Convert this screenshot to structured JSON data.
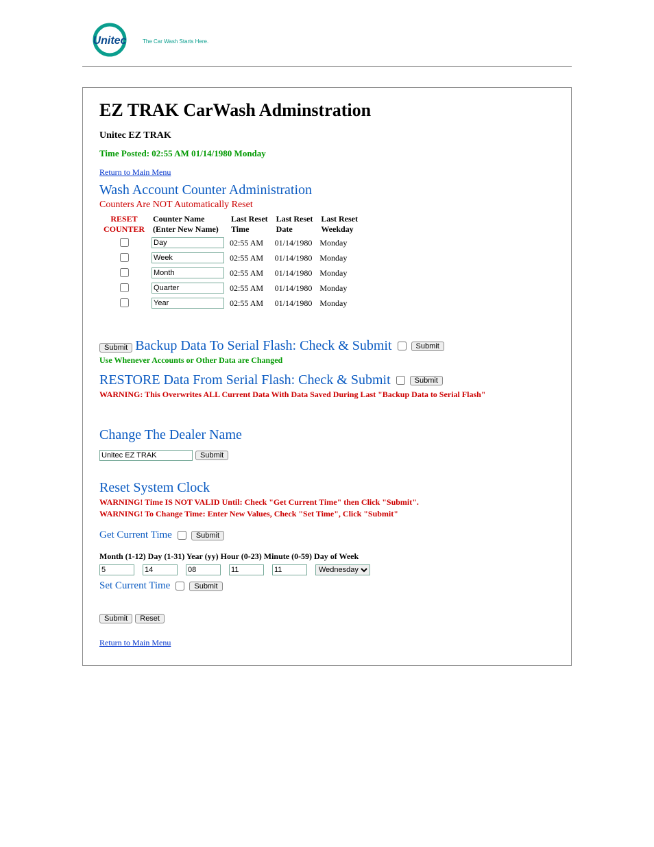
{
  "logo": {
    "brand": "Unitec",
    "tagline": "The Car Wash Starts Here."
  },
  "header": {
    "title": "EZ TRAK CarWash Adminstration",
    "subtitle": "Unitec EZ TRAK",
    "time_posted": "Time Posted: 02:55 AM 01/14/1980 Monday",
    "return_link": "Return to Main Menu"
  },
  "counters": {
    "heading": "Wash Account Counter Administration",
    "sub": "Counters Are NOT Automatically Reset",
    "cols": {
      "reset1": "RESET",
      "reset2": "COUNTER",
      "name1": "Counter Name",
      "name2": "(Enter New Name)",
      "time1": "Last Reset",
      "time2": "Time",
      "date1": "Last Reset",
      "date2": "Date",
      "wd1": "Last Reset",
      "wd2": "Weekday"
    },
    "rows": [
      {
        "name": "Day",
        "time": "02:55 AM",
        "date": "01/14/1980",
        "weekday": "Monday"
      },
      {
        "name": "Week",
        "time": "02:55 AM",
        "date": "01/14/1980",
        "weekday": "Monday"
      },
      {
        "name": "Month",
        "time": "02:55 AM",
        "date": "01/14/1980",
        "weekday": "Monday"
      },
      {
        "name": "Quarter",
        "time": "02:55 AM",
        "date": "01/14/1980",
        "weekday": "Monday"
      },
      {
        "name": "Year",
        "time": "02:55 AM",
        "date": "01/14/1980",
        "weekday": "Monday"
      }
    ],
    "submit": "Submit"
  },
  "backup": {
    "heading": "Backup Data To Serial Flash: Check & Submit",
    "submit": "Submit",
    "note": "Use Whenever Accounts or Other Data are Changed"
  },
  "restore": {
    "heading": "RESTORE Data From Serial Flash: Check & Submit",
    "submit": "Submit",
    "warn": "WARNING: This Overwrites ALL Current Data With Data Saved During Last \"Backup Data to Serial Flash\""
  },
  "dealer": {
    "heading": "Change The Dealer Name",
    "value": "Unitec EZ TRAK",
    "submit": "Submit"
  },
  "clock": {
    "heading": "Reset System Clock",
    "warn1": "WARNING! Time IS NOT VALID Until: Check \"Get Current Time\" then Click \"Submit\".",
    "warn2": "WARNING! To Change Time: Enter New Values, Check \"Set Time\", Click \"Submit\"",
    "get_label": "Get Current Time",
    "get_submit": "Submit",
    "labels": "Month (1-12) Day (1-31) Year (yy) Hour (0-23) Minute (0-59)   Day of Week",
    "month": "5",
    "day": "14",
    "year": "08",
    "hour": "11",
    "minute": "11",
    "dow": "Wednesday",
    "set_label": "Set Current Time",
    "set_submit": "Submit"
  },
  "footer": {
    "submit": "Submit",
    "reset": "Reset",
    "return_link": "Return to Main Menu"
  }
}
